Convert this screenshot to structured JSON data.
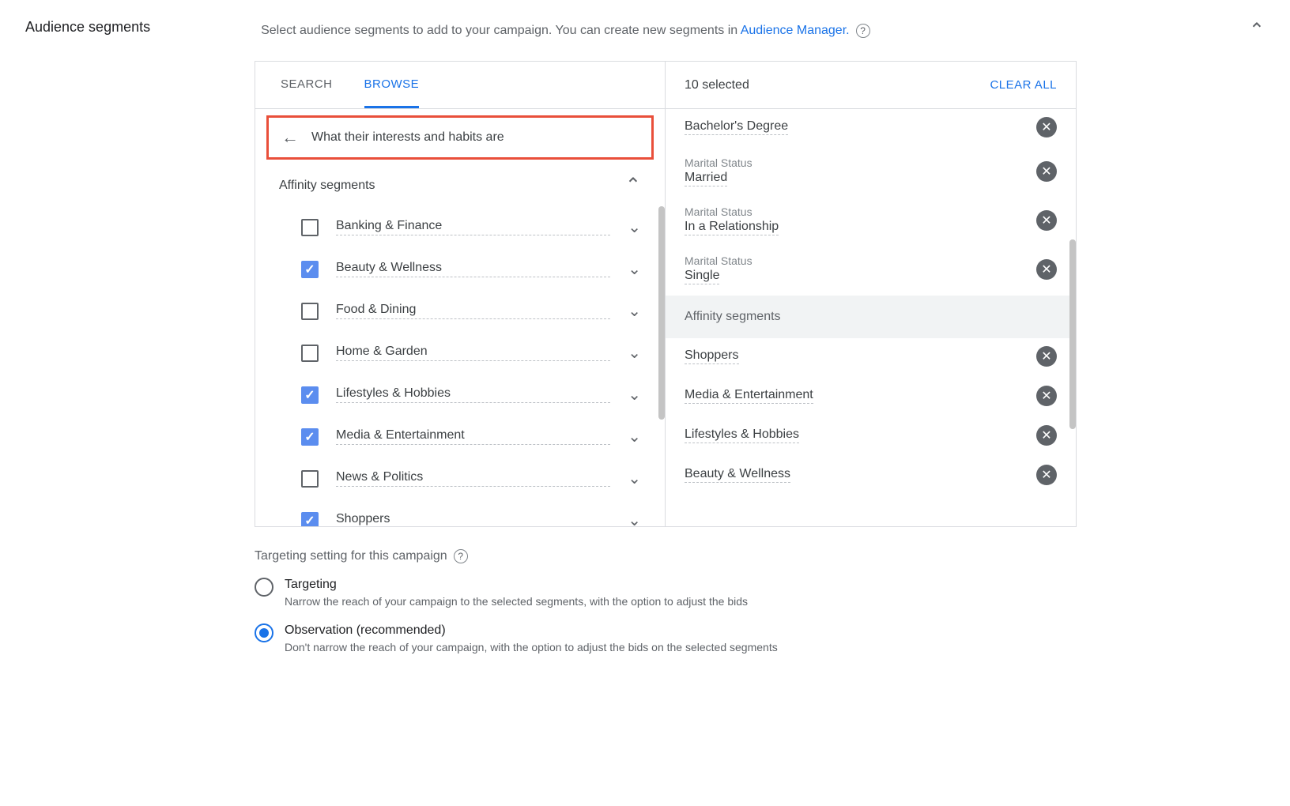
{
  "header": {
    "title": "Audience segments",
    "description": "Select audience segments to add to your campaign. You can create new segments in ",
    "link_text": "Audience Manager.",
    "help": "?"
  },
  "tabs": {
    "search": "SEARCH",
    "browse": "BROWSE"
  },
  "breadcrumb": "What their interests and habits are",
  "category": {
    "title": "Affinity segments"
  },
  "items": [
    {
      "label": "Banking & Finance",
      "checked": false
    },
    {
      "label": "Beauty & Wellness",
      "checked": true
    },
    {
      "label": "Food & Dining",
      "checked": false
    },
    {
      "label": "Home & Garden",
      "checked": false
    },
    {
      "label": "Lifestyles & Hobbies",
      "checked": true
    },
    {
      "label": "Media & Entertainment",
      "checked": true
    },
    {
      "label": "News & Politics",
      "checked": false
    },
    {
      "label": "Shoppers",
      "checked": true
    }
  ],
  "selected": {
    "count_label": "10 selected",
    "clear_all": "CLEAR ALL",
    "group1_title": "Affinity segments",
    "rows": [
      {
        "category": "",
        "value": "Bachelor's Degree"
      },
      {
        "category": "Marital Status",
        "value": "Married"
      },
      {
        "category": "Marital Status",
        "value": "In a Relationship"
      },
      {
        "category": "Marital Status",
        "value": "Single"
      }
    ],
    "affinity_rows": [
      {
        "value": "Shoppers"
      },
      {
        "value": "Media & Entertainment"
      },
      {
        "value": "Lifestyles & Hobbies"
      },
      {
        "value": "Beauty & Wellness"
      }
    ]
  },
  "targeting": {
    "title": "Targeting setting for this campaign",
    "opt1_label": "Targeting",
    "opt1_desc": "Narrow the reach of your campaign to the selected segments, with the option to adjust the bids",
    "opt2_label": "Observation (recommended)",
    "opt2_desc": "Don't narrow the reach of your campaign, with the option to adjust the bids on the selected segments"
  }
}
